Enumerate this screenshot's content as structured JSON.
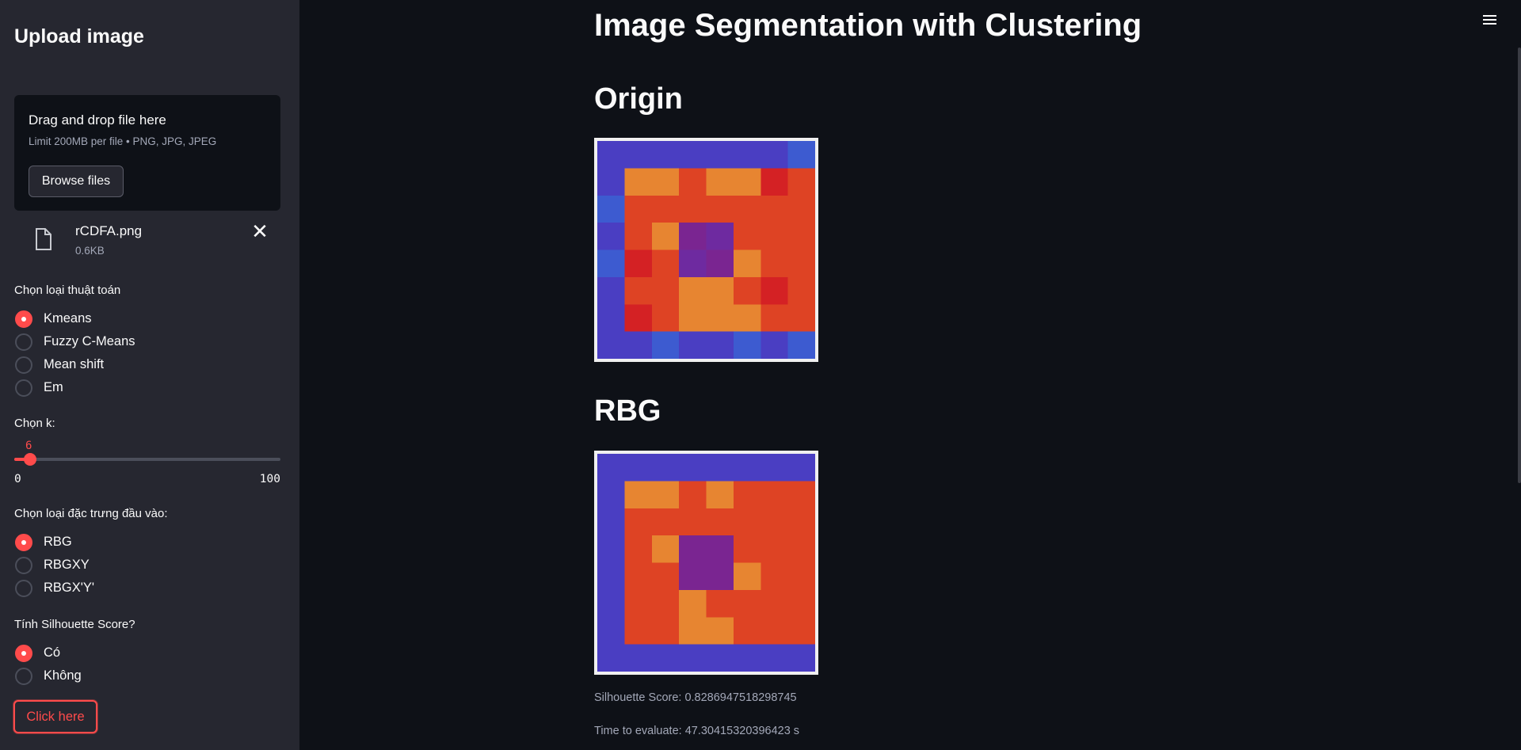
{
  "sidebar": {
    "title": "Upload image",
    "uploader": {
      "drag_text": "Drag and drop file here",
      "limit_text": "Limit 200MB per file • PNG, JPG, JPEG",
      "browse_label": "Browse files"
    },
    "file": {
      "name": "rCDFA.png",
      "size": "0.6KB",
      "close_glyph": "✕"
    },
    "algorithm": {
      "label": "Chọn loại thuật toán",
      "options": [
        "Kmeans",
        "Fuzzy C-Means",
        "Mean shift",
        "Em"
      ],
      "selected": "Kmeans"
    },
    "k": {
      "label": "Chọn k:",
      "value": 6,
      "min": 0,
      "max": 100
    },
    "features": {
      "label": "Chọn loại đặc trưng đầu vào:",
      "options": [
        "RBG",
        "RBGXY",
        "RBGX'Y'"
      ],
      "selected": "RBG"
    },
    "silhouette": {
      "label": "Tính Silhouette Score?",
      "options": [
        "Có",
        "Không"
      ],
      "selected": "Có"
    },
    "submit_label": "Click here"
  },
  "main": {
    "title": "Image Segmentation with Clustering",
    "origin_heading": "Origin",
    "result_heading": "RBG",
    "silhouette_text": "Silhouette Score: 0.8286947518298745",
    "time_text": "Time to evaluate: 47.30415320396423 s"
  },
  "colors": {
    "accent": "#ff4b4b",
    "background": "#0e1117",
    "sidebar_bg": "#262730"
  },
  "icons": {
    "file": "file-icon",
    "close": "close-icon",
    "menu": "hamburger-menu-icon"
  }
}
